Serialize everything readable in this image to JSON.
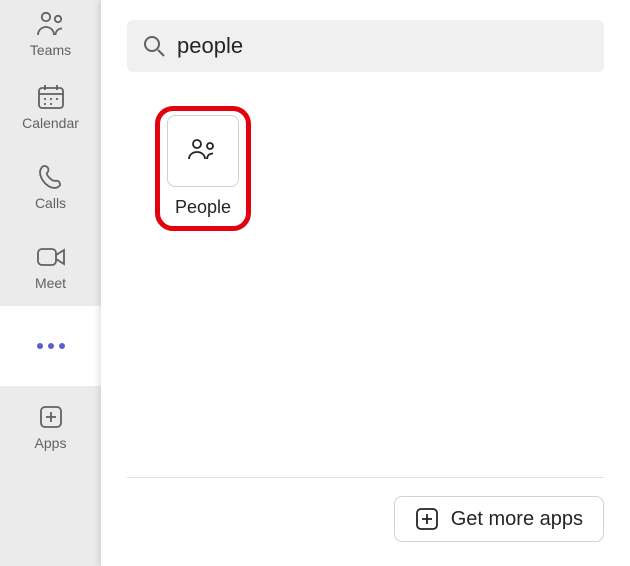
{
  "rail": {
    "teams": {
      "label": "Teams"
    },
    "calendar": {
      "label": "Calendar"
    },
    "calls": {
      "label": "Calls"
    },
    "meet": {
      "label": "Meet"
    },
    "apps": {
      "label": "Apps"
    }
  },
  "search": {
    "value": "people"
  },
  "results": {
    "items": [
      {
        "label": "People"
      }
    ]
  },
  "footer": {
    "get_more_label": "Get more apps"
  }
}
